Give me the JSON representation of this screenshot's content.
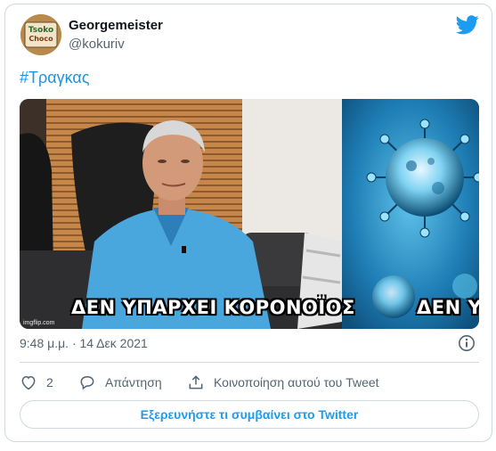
{
  "author": {
    "display_name": "Georgemeister",
    "handle": "@kokuriv",
    "avatar_icon": "avatar-image",
    "avatar_text_line1": "Tsoko",
    "avatar_text_line2": "Choco"
  },
  "tweet": {
    "text": "#Τραγκας",
    "timestamp": "9:48 μ.μ. · 14 Δεκ 2021"
  },
  "media": {
    "caption_left": "ΔΕΝ ΥΠΑΡΧΕΙ ΚΟΡΟΝΟΪΟΣ",
    "caption_right": "ΔΕΝ ΥΠ",
    "watermark": "imgflip.com"
  },
  "actions": {
    "like_count": "2",
    "reply_label": "Απάντηση",
    "share_label": "Κοινοποίηση αυτού του Tweet"
  },
  "footer": {
    "explore_label": "Εξερευνήστε τι συμβαίνει στο Twitter"
  },
  "colors": {
    "accent": "#1d9bf0",
    "hashtag": "#1b95e0",
    "secondary_text": "#536471",
    "border": "#cfd9de"
  },
  "icons": [
    "twitter-bird-icon",
    "info-icon",
    "heart-icon",
    "reply-bubble-icon",
    "share-icon"
  ]
}
